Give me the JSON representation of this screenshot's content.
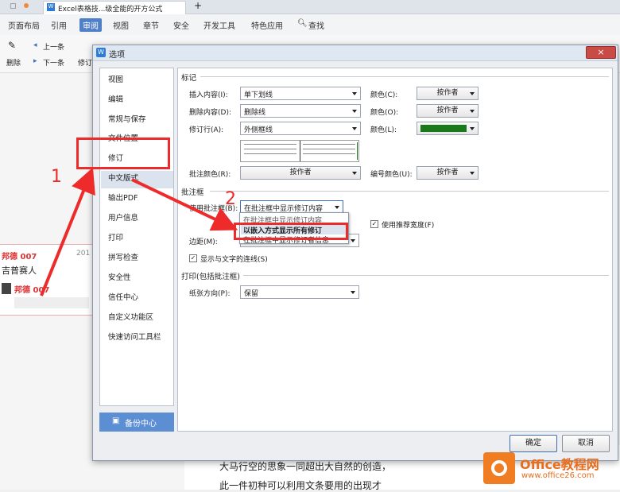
{
  "app_tabs": {
    "doc_tab": "Excel表格技...级全能的开方公式",
    "new_tab": "+"
  },
  "ribbon_tabs": [
    "页面布局",
    "引用",
    "审阅",
    "视图",
    "章节",
    "安全",
    "开发工具",
    "特色应用"
  ],
  "ribbon_search": "查找",
  "ribbon_active": "审阅",
  "ribbon_buttons": {
    "prev": "上一条",
    "next": "下一条",
    "delete": "删除",
    "revise": "修订"
  },
  "doc_bg": {
    "comment_title": "邦德 007",
    "comment_year": "201",
    "comment_text": "吉普赛人",
    "comment_author": "邦德 007",
    "body_line1": "大马行空的思象一同超出大自然的创造，",
    "body_line2": "此一件初种可以利用文条要用的出现才"
  },
  "dialog": {
    "title": "选项",
    "close": "×",
    "nav": [
      "视图",
      "编辑",
      "常规与保存",
      "文件位置",
      "修订",
      "中文版式",
      "输出PDF",
      "用户信息",
      "打印",
      "拼写检查",
      "安全性",
      "信任中心",
      "自定义功能区",
      "快速访问工具栏"
    ],
    "selected_nav": "修订",
    "backup_label": "备份中心",
    "sections": {
      "markup": "标记",
      "balloons": "批注框",
      "print": "打印(包括批注框)"
    },
    "markup": {
      "insert_label": "插入内容(I):",
      "insert_value": "单下划线",
      "delete_label": "删除内容(D):",
      "delete_value": "删除线",
      "revline_label": "修订行(A):",
      "revline_value": "外侧框线",
      "color_c_label": "颜色(C):",
      "color_c_value": "按作者",
      "color_o_label": "颜色(O):",
      "color_o_value": "按作者",
      "color_l_label": "颜色(L):",
      "color_l_swatch": "#1a7a1a",
      "comment_color_label": "批注颜色(R):",
      "comment_color_value": "按作者",
      "number_color_label": "编号颜色(U):",
      "number_color_value": "按作者"
    },
    "balloons": {
      "use_label": "使用批注框(B):",
      "use_value": "在批注框中显示修订内容",
      "dropdown_options": [
        "在批注框中显示修订内容",
        "以嵌入方式显示所有修订",
        "在批注框中显示修订者信息"
      ],
      "preferred_width_label": "使用推荐宽度(F)",
      "margin_label": "边距(M):",
      "show_lines_label": "显示与文字的连线(S)"
    },
    "print": {
      "orientation_label": "纸张方向(P):",
      "orientation_value": "保留"
    },
    "ok": "确定",
    "cancel": "取消"
  },
  "annotations": {
    "step1": "1",
    "step2": "2"
  },
  "watermark": {
    "brand": "Office教程网",
    "url": "www.office26.com"
  },
  "colors": {
    "accent": "#5b8ed2",
    "annotation": "#ee2b2b",
    "selection": "#dbe3ee"
  }
}
